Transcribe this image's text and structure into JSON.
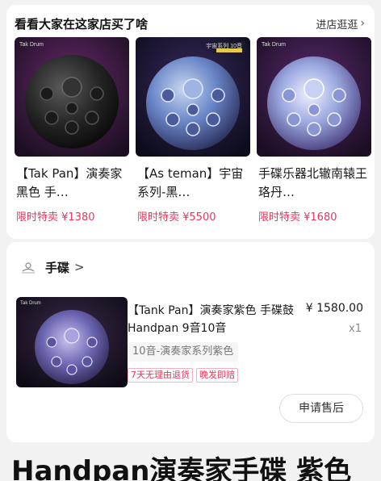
{
  "store": {
    "title": "看看大家在这家店买了啥",
    "link_label": "进店逛逛",
    "products": [
      {
        "name": "【Tak Pan】演奏家黑色 手…",
        "price": "限时特卖 ¥1380",
        "tag": "Tak Drum"
      },
      {
        "name": "【As teman】宇宙系列-黑…",
        "price": "限时特卖 ¥5500",
        "tag": "宇宙系列 10音"
      },
      {
        "name": "手碟乐器北辙南辕王珞丹…",
        "price": "限时特卖 ¥1680",
        "tag": "Tak Drum"
      }
    ]
  },
  "order": {
    "shop_name": "手碟",
    "item": {
      "title": "【Tank Pan】演奏家紫色 手碟鼓Handpan 9音10音",
      "price": "¥ 1580.00",
      "qty": "x1",
      "sku": "10音-演奏家系列紫色",
      "tags": [
        "7天无理由退货",
        "晚发即赔"
      ],
      "thumb_tag": "Tak Drum"
    },
    "after_sale_label": "申请售后"
  },
  "product_title": "Handpan演奏家手碟 紫色",
  "colors": {
    "accent": "#e8355a",
    "background": "#f2f2f2"
  },
  "icons": {
    "shop": "shop-icon",
    "chevron": "chevron-right-icon"
  }
}
